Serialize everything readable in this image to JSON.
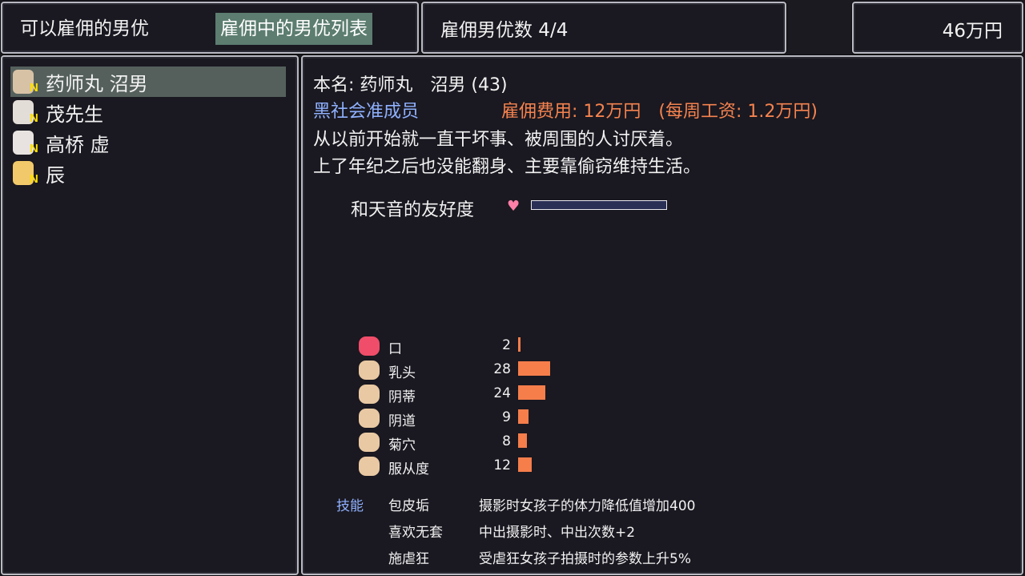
{
  "header": {
    "tab_available": "可以雇佣的男优",
    "tab_hired": "雇佣中的男优列表",
    "hired_count": "雇佣男优数 4/4",
    "money": "46万円"
  },
  "actor_list": [
    {
      "name": "药师丸 沼男",
      "badge": "N",
      "selected": true
    },
    {
      "name": "茂先生",
      "badge": "N",
      "selected": false
    },
    {
      "name": "高桥 虚",
      "badge": "N",
      "selected": false
    },
    {
      "name": "辰",
      "badge": "N",
      "selected": false
    }
  ],
  "detail": {
    "real_name": "本名: 药师丸　沼男 (43)",
    "rank": "黑社会准成员",
    "fee": "雇佣费用: 12万円　(每周工资: 1.2万円)",
    "bio_line1": "从以前开始就一直干坏事、被周围的人讨厌着。",
    "bio_line2": "上了年纪之后也没能翻身、主要靠偷窃维持生活。",
    "friendship_label": "和天音的友好度",
    "friendship_level": 0
  },
  "stats": [
    {
      "label": "口",
      "value": "2",
      "icon": "mouth-icon"
    },
    {
      "label": "乳头",
      "value": "28",
      "icon": "chest-icon"
    },
    {
      "label": "阴蒂",
      "value": "24",
      "icon": "clit-icon"
    },
    {
      "label": "阴道",
      "value": "9",
      "icon": "vagina-icon"
    },
    {
      "label": "菊穴",
      "value": "8",
      "icon": "anal-icon"
    },
    {
      "label": "服从度",
      "value": "12",
      "icon": "obedience-icon"
    }
  ],
  "skills": {
    "header": "技能",
    "items": [
      {
        "name": "包皮垢",
        "desc": "摄影时女孩子的体力降低值增加400"
      },
      {
        "name": "喜欢无套",
        "desc": "中出摄影时、中出次数+2"
      },
      {
        "name": "施虐狂",
        "desc": "受虐狂女孩子拍摄时的参数上升5%"
      }
    ]
  },
  "colors": {
    "rank": "#8fb1ff",
    "fee": "#f5834f",
    "bar": "#f57e4b",
    "tab_active_bg": "#5c7d70",
    "select_bg": "#55605c",
    "badge": "#ffe000"
  }
}
